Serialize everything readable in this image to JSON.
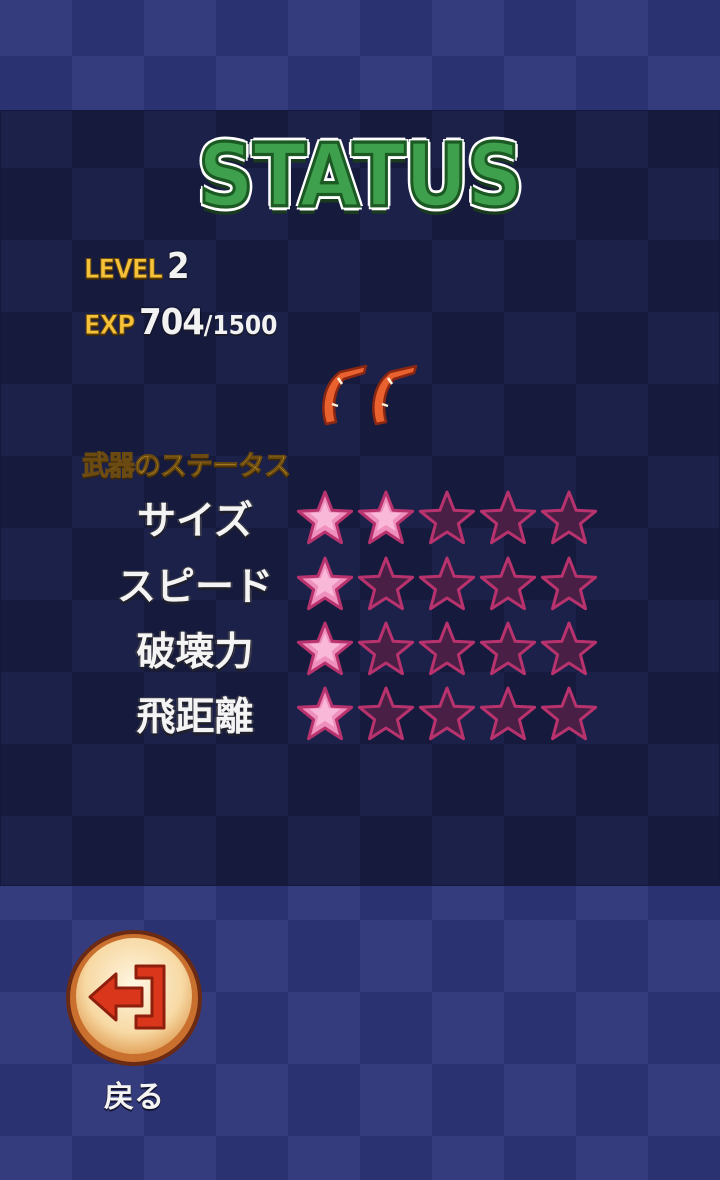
{
  "title": "STATUS",
  "level": {
    "label": "LEVEL",
    "value": "2"
  },
  "exp": {
    "label": "EXP",
    "current": "704",
    "separator": "/",
    "max": "1500"
  },
  "weapon_status": {
    "heading": "武器のステータス",
    "max_stars": 5,
    "stats": [
      {
        "label": "サイズ",
        "stars": 2
      },
      {
        "label": "スピード",
        "stars": 1
      },
      {
        "label": "破壊力",
        "stars": 1
      },
      {
        "label": "飛距離",
        "stars": 1
      }
    ]
  },
  "weapon_icons": [
    "boomerang-icon",
    "boomerang-icon"
  ],
  "back_button": {
    "label": "戻る",
    "icon": "exit-arrow-icon"
  },
  "colors": {
    "title_green": "#3ea04d",
    "label_yellow": "#f6c239",
    "star_filled": "#ef8fbd",
    "star_empty": "#4a1f45",
    "star_outline": "#b8336e",
    "button_face": "#f9ddb0",
    "button_icon": "#d9361b"
  }
}
